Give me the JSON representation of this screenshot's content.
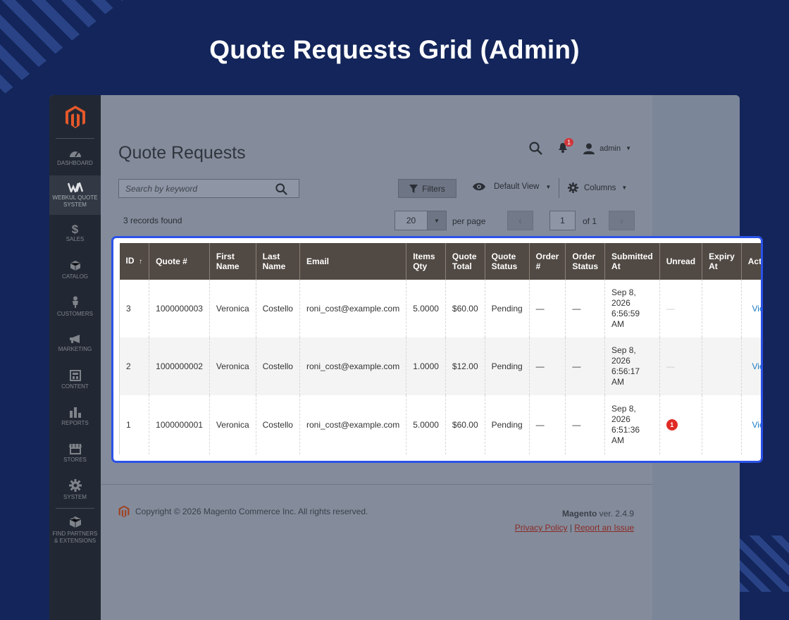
{
  "hero_title": "Quote Requests Grid (Admin)",
  "sidebar": {
    "items": [
      {
        "label": "Dashboard",
        "icon": "dashboard-icon"
      },
      {
        "label": "Webkul Quote System",
        "icon": "webkul-icon"
      },
      {
        "label": "Sales",
        "icon": "dollar-icon"
      },
      {
        "label": "Catalog",
        "icon": "box-icon"
      },
      {
        "label": "Customers",
        "icon": "person-icon"
      },
      {
        "label": "Marketing",
        "icon": "megaphone-icon"
      },
      {
        "label": "Content",
        "icon": "layout-icon"
      },
      {
        "label": "Reports",
        "icon": "bar-chart-icon"
      },
      {
        "label": "Stores",
        "icon": "store-icon"
      },
      {
        "label": "System",
        "icon": "gear-icon"
      },
      {
        "label": "Find Partners & Extensions",
        "icon": "cube-icon"
      }
    ]
  },
  "header": {
    "page_title": "Quote Requests",
    "notification_count": "1",
    "user": "admin"
  },
  "toolbar": {
    "search_placeholder": "Search by keyword",
    "filters_label": "Filters",
    "view_label": "Default View",
    "columns_label": "Columns",
    "records_found": "3 records found",
    "per_page_value": "20",
    "per_page_label": "per page",
    "page_current": "1",
    "page_of": "of 1"
  },
  "grid": {
    "columns": [
      {
        "line1": "ID",
        "line2": "",
        "sort": "↑"
      },
      {
        "line1": "Quote #",
        "line2": ""
      },
      {
        "line1": "First",
        "line2": "Name"
      },
      {
        "line1": "Last",
        "line2": "Name"
      },
      {
        "line1": "Email",
        "line2": ""
      },
      {
        "line1": "Items",
        "line2": "Qty"
      },
      {
        "line1": "Quote",
        "line2": "Total"
      },
      {
        "line1": "Quote",
        "line2": "Status"
      },
      {
        "line1": "Order",
        "line2": "#"
      },
      {
        "line1": "Order",
        "line2": "Status"
      },
      {
        "line1": "Submitted",
        "line2": "At"
      },
      {
        "line1": "Unread",
        "line2": ""
      },
      {
        "line1": "Expiry",
        "line2": "At"
      },
      {
        "line1": "Action",
        "line2": ""
      }
    ],
    "rows": [
      {
        "id": "3",
        "quote": "1000000003",
        "first": "Veronica",
        "last": "Costello",
        "email": "roni_cost@example.com",
        "qty": "5.0000",
        "total": "$60.00",
        "status": "Pending",
        "order": "—",
        "order_status": "—",
        "sub1": "Sep 8,",
        "sub2": "2026",
        "sub3": "6:56:59",
        "sub4": "AM",
        "unread": "—",
        "expiry": "",
        "action": "View"
      },
      {
        "id": "2",
        "quote": "1000000002",
        "first": "Veronica",
        "last": "Costello",
        "email": "roni_cost@example.com",
        "qty": "1.0000",
        "total": "$12.00",
        "status": "Pending",
        "order": "—",
        "order_status": "—",
        "sub1": "Sep 8,",
        "sub2": "2026",
        "sub3": "6:56:17",
        "sub4": "AM",
        "unread": "—",
        "expiry": "",
        "action": "View"
      },
      {
        "id": "1",
        "quote": "1000000001",
        "first": "Veronica",
        "last": "Costello",
        "email": "roni_cost@example.com",
        "qty": "5.0000",
        "total": "$60.00",
        "status": "Pending",
        "order": "—",
        "order_status": "—",
        "sub1": "Sep 8,",
        "sub2": "2026",
        "sub3": "6:51:36",
        "sub4": "AM",
        "unread": "1",
        "expiry": "",
        "action": "View"
      }
    ]
  },
  "footer": {
    "copyright": "Copyright © 2026 Magento Commerce Inc. All rights reserved.",
    "brand": "Magento",
    "version": " ver. 2.4.9",
    "privacy": "Privacy Policy",
    "separator": " | ",
    "report": "Report an Issue"
  },
  "colors": {
    "background": "#13255a",
    "table_header": "#514943",
    "highlight_border": "#2b52e8",
    "link": "#1979c3",
    "badge": "#e02b27"
  }
}
